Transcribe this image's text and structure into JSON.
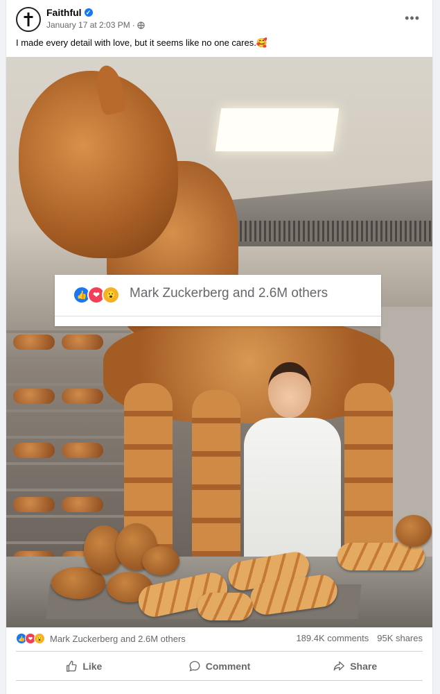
{
  "post": {
    "author": "Faithful",
    "timestamp": "January 17 at 2:03 PM",
    "text": "I made every detail with love, but it seems like no one cares.🥰"
  },
  "photo": {
    "overlay_reactions_text": "Mark Zuckerberg and 2.6M others"
  },
  "stats": {
    "reactions_text": "Mark Zuckerberg and 2.6M others",
    "comments": "189.4K comments",
    "shares": "95K shares"
  },
  "actions": {
    "like": "Like",
    "comment": "Comment",
    "share": "Share"
  },
  "reaction_icons": [
    "like-icon",
    "love-icon",
    "wow-icon"
  ],
  "colors": {
    "verified": "#1877f2",
    "like": "#1877f2",
    "love": "#f33e58",
    "wow": "#f7b125",
    "secondary_text": "#65676b"
  }
}
